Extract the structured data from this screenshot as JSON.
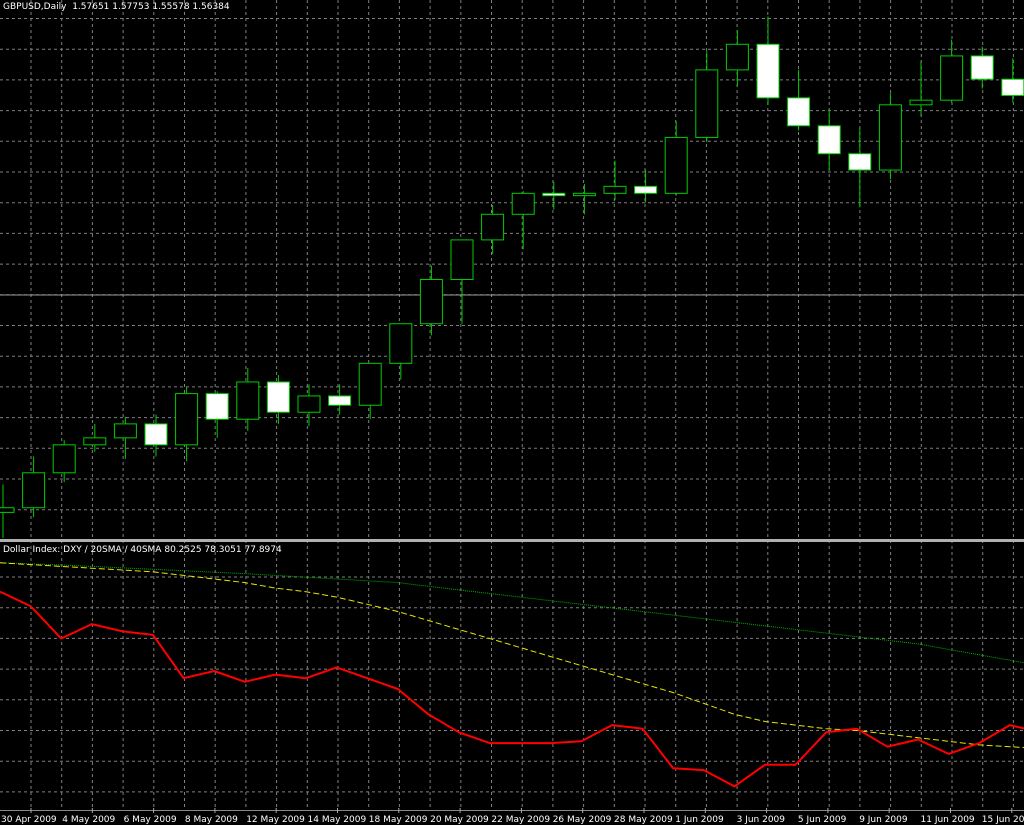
{
  "main_title": {
    "symbol": "GBPUSD,Daily",
    "values": "1.57651 1.57753 1.55578 1.56384"
  },
  "indicator_title": {
    "name": "Dollar Index: DXY / 20SMA / 40SMA",
    "values": "80.2525 78.3051 77.8974"
  },
  "colors": {
    "background": "#000000",
    "grid": "#7f7f7f",
    "bull_body": "#000000",
    "bear_body": "#ffffff",
    "candle_outline": "#00cc00",
    "dxy": "#ff0000",
    "sma20": "#e6e600",
    "sma40": "#00b000",
    "text": "#ffffff"
  },
  "chart_data": [
    {
      "type": "candlestick",
      "x_labels": [
        "30 Apr 2009",
        "4 May 2009",
        "6 May 2009",
        "8 May 2009",
        "12 May 2009",
        "14 May 2009",
        "18 May 2009",
        "20 May 2009",
        "22 May 2009",
        "26 May 2009",
        "28 May 2009",
        "1 Jun 2009",
        "3 Jun 2009",
        "5 Jun 2009",
        "9 Jun 2009",
        "11 Jun 2009",
        "15 Jun 2009"
      ],
      "ylim": [
        1.455,
        1.68
      ],
      "candles": [
        {
          "o": 1.466,
          "h": 1.478,
          "l": 1.455,
          "c": 1.468
        },
        {
          "o": 1.468,
          "h": 1.49,
          "l": 1.464,
          "c": 1.483
        },
        {
          "o": 1.483,
          "h": 1.497,
          "l": 1.479,
          "c": 1.495
        },
        {
          "o": 1.495,
          "h": 1.504,
          "l": 1.492,
          "c": 1.498
        },
        {
          "o": 1.498,
          "h": 1.507,
          "l": 1.489,
          "c": 1.504
        },
        {
          "o": 1.504,
          "h": 1.508,
          "l": 1.49,
          "c": 1.495
        },
        {
          "o": 1.495,
          "h": 1.52,
          "l": 1.488,
          "c": 1.517
        },
        {
          "o": 1.517,
          "h": 1.518,
          "l": 1.498,
          "c": 1.506
        },
        {
          "o": 1.506,
          "h": 1.528,
          "l": 1.501,
          "c": 1.522
        },
        {
          "o": 1.522,
          "h": 1.525,
          "l": 1.504,
          "c": 1.509
        },
        {
          "o": 1.509,
          "h": 1.521,
          "l": 1.503,
          "c": 1.516
        },
        {
          "o": 1.516,
          "h": 1.521,
          "l": 1.508,
          "c": 1.512
        },
        {
          "o": 1.512,
          "h": 1.525,
          "l": 1.506,
          "c": 1.53
        },
        {
          "o": 1.53,
          "h": 1.543,
          "l": 1.523,
          "c": 1.547
        },
        {
          "o": 1.547,
          "h": 1.572,
          "l": 1.542,
          "c": 1.566
        },
        {
          "o": 1.566,
          "h": 1.582,
          "l": 1.547,
          "c": 1.583
        },
        {
          "o": 1.583,
          "h": 1.598,
          "l": 1.577,
          "c": 1.594
        },
        {
          "o": 1.594,
          "h": 1.604,
          "l": 1.579,
          "c": 1.603
        },
        {
          "o": 1.603,
          "h": 1.608,
          "l": 1.596,
          "c": 1.602
        },
        {
          "o": 1.602,
          "h": 1.607,
          "l": 1.594,
          "c": 1.603
        },
        {
          "o": 1.603,
          "h": 1.617,
          "l": 1.6,
          "c": 1.606
        },
        {
          "o": 1.606,
          "h": 1.613,
          "l": 1.599,
          "c": 1.603
        },
        {
          "o": 1.603,
          "h": 1.634,
          "l": 1.602,
          "c": 1.627
        },
        {
          "o": 1.627,
          "h": 1.664,
          "l": 1.625,
          "c": 1.656
        },
        {
          "o": 1.656,
          "h": 1.673,
          "l": 1.649,
          "c": 1.667
        },
        {
          "o": 1.667,
          "h": 1.679,
          "l": 1.641,
          "c": 1.644
        },
        {
          "o": 1.644,
          "h": 1.656,
          "l": 1.63,
          "c": 1.632
        },
        {
          "o": 1.632,
          "h": 1.639,
          "l": 1.613,
          "c": 1.62
        },
        {
          "o": 1.62,
          "h": 1.631,
          "l": 1.597,
          "c": 1.613
        },
        {
          "o": 1.613,
          "h": 1.646,
          "l": 1.609,
          "c": 1.641
        },
        {
          "o": 1.641,
          "h": 1.66,
          "l": 1.636,
          "c": 1.643
        },
        {
          "o": 1.643,
          "h": 1.669,
          "l": 1.642,
          "c": 1.662
        },
        {
          "o": 1.662,
          "h": 1.666,
          "l": 1.648,
          "c": 1.652
        },
        {
          "o": 1.652,
          "h": 1.661,
          "l": 1.642,
          "c": 1.645
        },
        {
          "o": 1.645,
          "h": 1.657,
          "l": 1.638,
          "c": 1.653
        }
      ]
    },
    {
      "type": "line",
      "title": "Dollar Index: DXY / 20SMA / 40SMA",
      "ylim": [
        78.3,
        85.4
      ],
      "series": [
        {
          "name": "DXY",
          "values": [
            84.3,
            83.9,
            83.0,
            83.4,
            83.2,
            83.1,
            81.9,
            82.1,
            81.8,
            82.0,
            81.9,
            82.2,
            81.9,
            81.6,
            80.9,
            80.4,
            80.1,
            80.1,
            80.1,
            80.15,
            80.6,
            80.5,
            79.4,
            79.35,
            78.9,
            79.5,
            79.5,
            80.4,
            80.5,
            80.0,
            80.2,
            79.8,
            80.1,
            80.6,
            80.4,
            80.2
          ]
        },
        {
          "name": "20SMA",
          "values": [
            85.1,
            85.05,
            85.0,
            84.95,
            84.9,
            84.85,
            84.75,
            84.65,
            84.55,
            84.4,
            84.3,
            84.15,
            83.95,
            83.75,
            83.5,
            83.25,
            83.0,
            82.75,
            82.5,
            82.25,
            82.0,
            81.75,
            81.5,
            81.2,
            80.9,
            80.7,
            80.6,
            80.5,
            80.45,
            80.35,
            80.25,
            80.15,
            80.05,
            80.0,
            79.95,
            79.9
          ]
        },
        {
          "name": "40SMA",
          "values": [
            85.1,
            85.07,
            85.04,
            85.0,
            84.96,
            84.92,
            84.88,
            84.84,
            84.8,
            84.75,
            84.7,
            84.65,
            84.6,
            84.55,
            84.45,
            84.35,
            84.25,
            84.15,
            84.05,
            83.95,
            83.85,
            83.75,
            83.65,
            83.55,
            83.45,
            83.35,
            83.25,
            83.15,
            83.05,
            82.95,
            82.85,
            82.7,
            82.55,
            82.4,
            82.25,
            82.1
          ]
        }
      ]
    }
  ]
}
